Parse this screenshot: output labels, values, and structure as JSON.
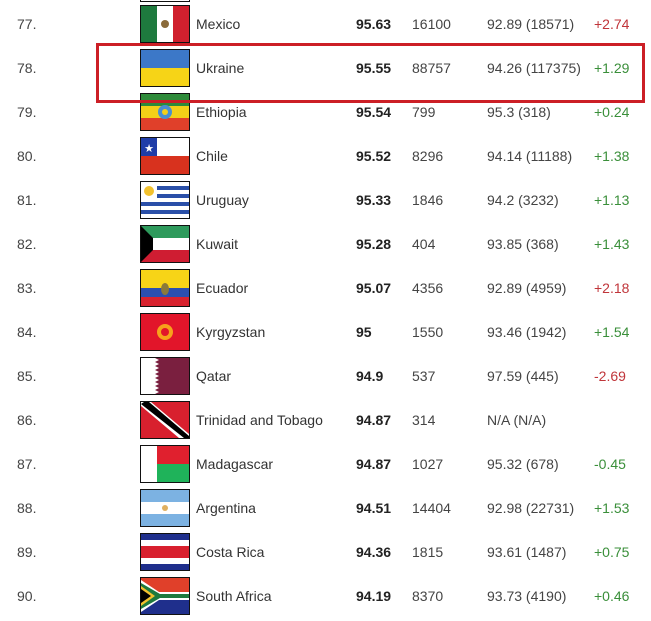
{
  "table": {
    "rows": [
      {
        "rank": "77.",
        "country": "Mexico",
        "flag": "mexico-flag",
        "score": "95.63",
        "count": "16100",
        "previous": "92.89 (18571)",
        "change": "+2.74",
        "change_trend": "neg",
        "highlighted": false
      },
      {
        "rank": "78.",
        "country": "Ukraine",
        "flag": "ukraine-flag",
        "score": "95.55",
        "count": "88757",
        "previous": "94.26 (117375)",
        "change": "+1.29",
        "change_trend": "pos",
        "highlighted": true
      },
      {
        "rank": "79.",
        "country": "Ethiopia",
        "flag": "ethiopia-flag",
        "score": "95.54",
        "count": "799",
        "previous": "95.3 (318)",
        "change": "+0.24",
        "change_trend": "pos",
        "highlighted": false
      },
      {
        "rank": "80.",
        "country": "Chile",
        "flag": "chile-flag",
        "score": "95.52",
        "count": "8296",
        "previous": "94.14 (11188)",
        "change": "+1.38",
        "change_trend": "pos",
        "highlighted": false
      },
      {
        "rank": "81.",
        "country": "Uruguay",
        "flag": "uruguay-flag",
        "score": "95.33",
        "count": "1846",
        "previous": "94.2 (3232)",
        "change": "+1.13",
        "change_trend": "pos",
        "highlighted": false
      },
      {
        "rank": "82.",
        "country": "Kuwait",
        "flag": "kuwait-flag",
        "score": "95.28",
        "count": "404",
        "previous": "93.85 (368)",
        "change": "+1.43",
        "change_trend": "pos",
        "highlighted": false
      },
      {
        "rank": "83.",
        "country": "Ecuador",
        "flag": "ecuador-flag",
        "score": "95.07",
        "count": "4356",
        "previous": "92.89 (4959)",
        "change": "+2.18",
        "change_trend": "neg",
        "highlighted": false
      },
      {
        "rank": "84.",
        "country": "Kyrgyzstan",
        "flag": "kyrgyzstan-flag",
        "score": "95",
        "count": "1550",
        "previous": "93.46 (1942)",
        "change": "+1.54",
        "change_trend": "pos",
        "highlighted": false
      },
      {
        "rank": "85.",
        "country": "Qatar",
        "flag": "qatar-flag",
        "score": "94.9",
        "count": "537",
        "previous": "97.59 (445)",
        "change": "-2.69",
        "change_trend": "neg",
        "highlighted": false
      },
      {
        "rank": "86.",
        "country": "Trinidad and Tobago",
        "flag": "trinidad-and-tobago-flag",
        "score": "94.87",
        "count": "314",
        "previous": "N/A (N/A)",
        "change": "",
        "change_trend": "none",
        "highlighted": false
      },
      {
        "rank": "87.",
        "country": "Madagascar",
        "flag": "madagascar-flag",
        "score": "94.87",
        "count": "1027",
        "previous": "95.32 (678)",
        "change": "-0.45",
        "change_trend": "pos",
        "highlighted": false
      },
      {
        "rank": "88.",
        "country": "Argentina",
        "flag": "argentina-flag",
        "score": "94.51",
        "count": "14404",
        "previous": "92.98 (22731)",
        "change": "+1.53",
        "change_trend": "pos",
        "highlighted": false
      },
      {
        "rank": "89.",
        "country": "Costa Rica",
        "flag": "costa-rica-flag",
        "score": "94.36",
        "count": "1815",
        "previous": "93.61 (1487)",
        "change": "+0.75",
        "change_trend": "pos",
        "highlighted": false
      },
      {
        "rank": "90.",
        "country": "South Africa",
        "flag": "south-africa-flag",
        "score": "94.19",
        "count": "8370",
        "previous": "93.73 (4190)",
        "change": "+0.46",
        "change_trend": "pos",
        "highlighted": false
      }
    ]
  },
  "colors": {
    "positive_change": "#3a8f3a",
    "negative_change": "#c0353a",
    "highlight_border": "#cc1f26"
  }
}
